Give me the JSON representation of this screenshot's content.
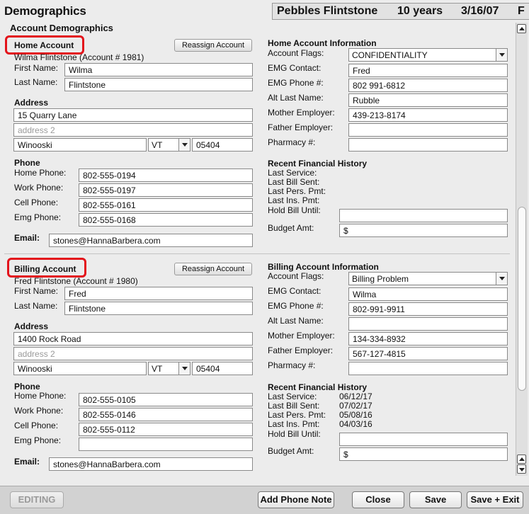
{
  "window": {
    "title": "Demographics",
    "patient_name": "Pebbles Flintstone",
    "age": "10 years",
    "dob": "3/16/07",
    "sex": "F",
    "section_title": "Account Demographics"
  },
  "home": {
    "header": "Home Account",
    "reassign": "Reassign Account",
    "account_line": "Wilma Flintstone (Account # 1981)",
    "first_name_label": "First Name:",
    "first_name": "Wilma",
    "last_name_label": "Last Name:",
    "last_name": "Flintstone",
    "address_header": "Address",
    "address1": "15 Quarry Lane",
    "address2_placeholder": "address 2",
    "city": "Winooski",
    "state": "VT",
    "zip": "05404",
    "phone_header": "Phone",
    "home_phone_label": "Home Phone:",
    "home_phone": "802-555-0194",
    "work_phone_label": "Work Phone:",
    "work_phone": "802-555-0197",
    "cell_phone_label": "Cell Phone:",
    "cell_phone": "802-555-0161",
    "emg_phone_label": "Emg Phone:",
    "emg_phone": "802-555-0168",
    "email_label": "Email:",
    "email": "stones@HannaBarbera.com",
    "info_header": "Home Account Information",
    "flags_label": "Account Flags:",
    "flags": "CONFIDENTIALITY",
    "emg_contact_label": "EMG Contact:",
    "emg_contact": "Fred",
    "emg_phone2_label": "EMG Phone #:",
    "emg_phone2": "802 991-6812",
    "alt_last_label": "Alt Last Name:",
    "alt_last": "Rubble",
    "mother_label": "Mother Employer:",
    "mother": "439-213-8174",
    "father_label": "Father Employer:",
    "father": "",
    "pharmacy_label": "Pharmacy #:",
    "pharmacy": "",
    "fin_header": "Recent Financial History",
    "last_service_label": "Last Service:",
    "last_service": "",
    "last_bill_label": "Last Bill Sent:",
    "last_bill": "",
    "last_pers_label": "Last Pers. Pmt:",
    "last_pers": "",
    "last_ins_label": "Last Ins. Pmt:",
    "last_ins": "",
    "hold_label": "Hold Bill Until:",
    "hold": "",
    "budget_label": "Budget Amt:",
    "budget": "$"
  },
  "billing": {
    "header": "Billing Account",
    "reassign": "Reassign Account",
    "account_line": "Fred Flintstone (Account # 1980)",
    "first_name_label": "First Name:",
    "first_name": "Fred",
    "last_name_label": "Last Name:",
    "last_name": "Flintstone",
    "address_header": "Address",
    "address1": "1400 Rock Road",
    "address2_placeholder": "address 2",
    "city": "Winooski",
    "state": "VT",
    "zip": "05404",
    "phone_header": "Phone",
    "home_phone_label": "Home Phone:",
    "home_phone": "802-555-0105",
    "work_phone_label": "Work Phone:",
    "work_phone": "802-555-0146",
    "cell_phone_label": "Cell Phone:",
    "cell_phone": "802-555-0112",
    "emg_phone_label": "Emg Phone:",
    "emg_phone": "",
    "email_label": "Email:",
    "email": "stones@HannaBarbera.com",
    "info_header": "Billing Account Information",
    "flags_label": "Account Flags:",
    "flags": "Billing Problem",
    "emg_contact_label": "EMG Contact:",
    "emg_contact": "Wilma",
    "emg_phone2_label": "EMG Phone #:",
    "emg_phone2": "802-991-9911",
    "alt_last_label": "Alt Last Name:",
    "alt_last": "",
    "mother_label": "Mother Employer:",
    "mother": "134-334-8932",
    "father_label": "Father Employer:",
    "father": "567-127-4815",
    "pharmacy_label": "Pharmacy #:",
    "pharmacy": "",
    "fin_header": "Recent Financial History",
    "last_service_label": "Last Service:",
    "last_service": "06/12/17",
    "last_bill_label": "Last Bill Sent:",
    "last_bill": "07/02/17",
    "last_pers_label": "Last Pers. Pmt:",
    "last_pers": "05/08/16",
    "last_ins_label": "Last Ins. Pmt:",
    "last_ins": "04/03/16",
    "hold_label": "Hold Bill Until:",
    "hold": "",
    "budget_label": "Budget Amt:",
    "budget": "$"
  },
  "toolbar": {
    "editing": "EDITING",
    "add_phone_note": "Add Phone Note",
    "close": "Close",
    "save": "Save",
    "save_exit": "Save + Exit"
  },
  "colors": {
    "highlight": "#e3131b",
    "background": "#ececec"
  }
}
